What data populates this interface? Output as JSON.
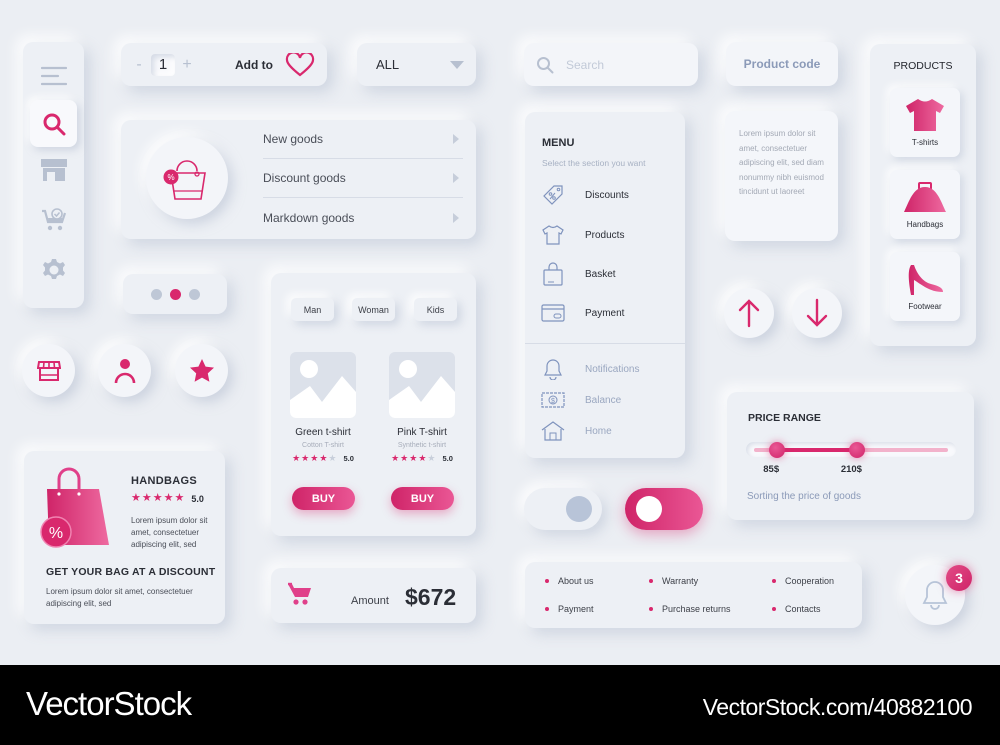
{
  "colors": {
    "accent": "#d9286d",
    "accent_light": "#ea5795",
    "background": "#ebeef3",
    "muted_icon": "#b7c0d0"
  },
  "sidebar": {
    "items": [
      {
        "icon": "menu-icon",
        "active": false
      },
      {
        "icon": "search-icon",
        "active": true
      },
      {
        "icon": "store-icon",
        "active": false
      },
      {
        "icon": "cart-check-icon",
        "active": false
      },
      {
        "icon": "gear-icon",
        "active": false
      }
    ]
  },
  "quantity": {
    "minus": "-",
    "value": "1",
    "plus": "+",
    "add_to_label": "Add to",
    "icon": "heart-icon"
  },
  "filter_dropdown": {
    "selected": "ALL"
  },
  "goods_menu": {
    "badge": "%",
    "items": [
      {
        "label": "New goods"
      },
      {
        "label": "Discount goods"
      },
      {
        "label": "Markdown goods"
      }
    ]
  },
  "pager": {
    "count": 3,
    "active_index": 1
  },
  "round_buttons": [
    {
      "icon": "store-icon"
    },
    {
      "icon": "user-icon"
    },
    {
      "icon": "star-icon"
    }
  ],
  "shop": {
    "segments": [
      {
        "label": "Man"
      },
      {
        "label": "Woman"
      },
      {
        "label": "Kids"
      }
    ],
    "products": [
      {
        "name": "Green t-shirt",
        "subtitle": "Cotton T-shirt",
        "stars_filled": 4,
        "stars_total": 5,
        "rating": "5.0",
        "buy_label": "BUY"
      },
      {
        "name": "Pink T-shirt",
        "subtitle": "Synthetic t-shirt",
        "stars_filled": 4,
        "stars_total": 5,
        "rating": "5.0",
        "buy_label": "BUY"
      }
    ]
  },
  "promo": {
    "title": "HANDBAGS",
    "stars_filled": 5,
    "rating": "5.0",
    "description": "Lorem ipsum dolor sit amet, consectetuer adipiscing elit, sed",
    "badge": "%",
    "headline": "GET YOUR BAG AT A DISCOUNT",
    "headline_text": "Lorem ipsum dolor sit amet, consectetuer adipiscing elit, sed"
  },
  "amount": {
    "label": "Amount",
    "value": "$672"
  },
  "search": {
    "placeholder": "Search",
    "value": ""
  },
  "product_code": {
    "label": "Product code"
  },
  "menu": {
    "title": "MENU",
    "subtitle": "Select the section you want",
    "primary": [
      {
        "label": "Discounts",
        "icon": "tag-percent-icon"
      },
      {
        "label": "Products",
        "icon": "tshirt-icon"
      },
      {
        "label": "Basket",
        "icon": "shopping-bag-icon"
      },
      {
        "label": "Payment",
        "icon": "credit-card-icon"
      }
    ],
    "secondary": [
      {
        "label": "Notifications",
        "icon": "bell-icon"
      },
      {
        "label": "Balance",
        "icon": "banknote-icon"
      },
      {
        "label": "Home",
        "icon": "home-icon"
      }
    ]
  },
  "lorem_card": {
    "text": "Lorem ipsum dolor sit amet, consectetuer adipiscing elit, sed diam nonummy nibh euismod tincidunt ut laoreet"
  },
  "arrows": [
    {
      "icon": "arrow-up-icon"
    },
    {
      "icon": "arrow-down-icon"
    }
  ],
  "products_panel": {
    "title": "PRODUCTS",
    "items": [
      {
        "label": "T-shirts"
      },
      {
        "label": "Handbags"
      },
      {
        "label": "Footwear"
      }
    ]
  },
  "price_range": {
    "title": "PRICE RANGE",
    "min_label": "85$",
    "max_label": "210$",
    "min_fraction": 0.12,
    "max_fraction": 0.53,
    "subtitle": "Sorting the price of goods"
  },
  "toggles": [
    {
      "state": "off"
    },
    {
      "state": "on"
    }
  ],
  "footer_links": [
    {
      "label": "About us"
    },
    {
      "label": "Warranty"
    },
    {
      "label": "Cooperation"
    },
    {
      "label": "Payment"
    },
    {
      "label": "Purchase returns"
    },
    {
      "label": "Contacts"
    }
  ],
  "notifications": {
    "count": "3"
  },
  "watermark": {
    "brand": "VectorStock",
    "url": "VectorStock.com/40882100"
  }
}
